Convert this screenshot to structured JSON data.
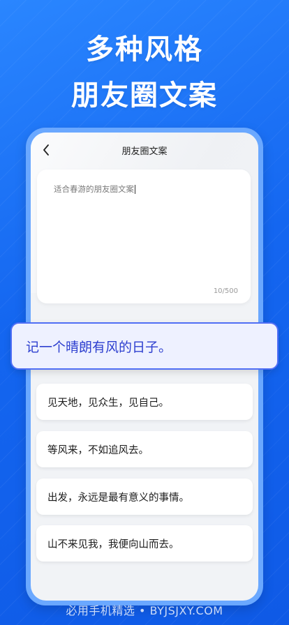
{
  "promo": {
    "headline_line1": "多种风格",
    "headline_line2": "朋友圈文案"
  },
  "screen": {
    "nav_title": "朋友圈文案",
    "input": {
      "value": "适合春游的朋友圈文案",
      "counter": "10/500"
    }
  },
  "highlight": {
    "text": "记一个晴朗有风的日子。"
  },
  "results": [
    {
      "text": "见天地，见众生，见自己。"
    },
    {
      "text": "等风来，不如追风去。"
    },
    {
      "text": "出发，永远是最有意义的事情。"
    },
    {
      "text": "山不来见我，我便向山而去。"
    }
  ],
  "watermark": "必用手机精选 • BYJSJXY.COM",
  "colors": {
    "background": "#1466f0",
    "phone_frame": "#6aa8ff",
    "highlight_border": "#4f6ef5",
    "highlight_text": "#2d3fcf"
  },
  "icons": {
    "back": "chevron-left-icon"
  }
}
